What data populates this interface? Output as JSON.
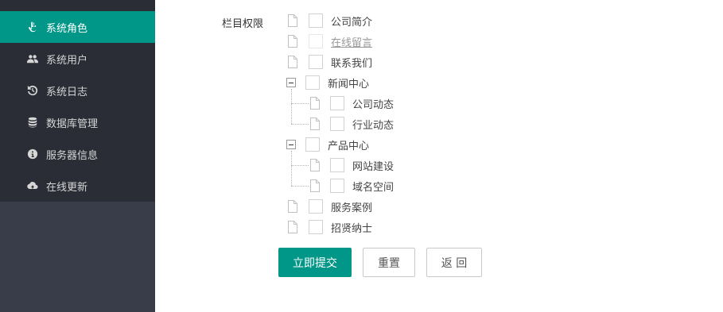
{
  "sidebar": {
    "items": [
      {
        "label": "系统角色",
        "icon": "hand-pointer-icon",
        "active": true
      },
      {
        "label": "系统用户",
        "icon": "users-icon",
        "active": false
      },
      {
        "label": "系统日志",
        "icon": "history-icon",
        "active": false
      },
      {
        "label": "数据库管理",
        "icon": "database-icon",
        "active": false
      },
      {
        "label": "服务器信息",
        "icon": "info-circle-icon",
        "active": false
      },
      {
        "label": "在线更新",
        "icon": "cloud-upload-icon",
        "active": false
      }
    ],
    "colors": {
      "bg": "#2a2d35",
      "active": "#009688",
      "lower_bg": "#393d49"
    }
  },
  "form": {
    "label": "栏目权限",
    "tree": [
      {
        "label": "公司简介"
      },
      {
        "label": "在线留言"
      },
      {
        "label": "联系我们"
      },
      {
        "label": "新闻中心",
        "expanded": true,
        "children": [
          {
            "label": "公司动态"
          },
          {
            "label": "行业动态"
          }
        ]
      },
      {
        "label": "产品中心",
        "expanded": true,
        "children": [
          {
            "label": "网站建设"
          },
          {
            "label": "域名空间"
          }
        ]
      },
      {
        "label": "服务案例"
      },
      {
        "label": "招贤纳士"
      }
    ],
    "buttons": {
      "submit": "立即提交",
      "reset": "重置",
      "back": "返 回"
    }
  },
  "accent_color": "#009688"
}
